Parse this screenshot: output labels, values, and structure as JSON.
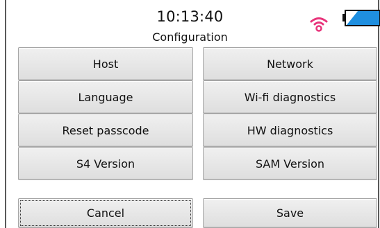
{
  "status": {
    "time": "10:13:40",
    "wifi_icon": "wifi-icon",
    "battery_icon": "battery-icon",
    "wifi_color": "#e8337a",
    "battery_color": "#1f8fe0"
  },
  "screen": {
    "title": "Configuration"
  },
  "menu": {
    "host": "Host",
    "network": "Network",
    "language": "Language",
    "wifi_diagnostics": "Wi-fi diagnostics",
    "reset_passcode": "Reset passcode",
    "hw_diagnostics": "HW diagnostics",
    "s4_version": "S4 Version",
    "sam_version": "SAM Version"
  },
  "actions": {
    "cancel": "Cancel",
    "save": "Save"
  }
}
